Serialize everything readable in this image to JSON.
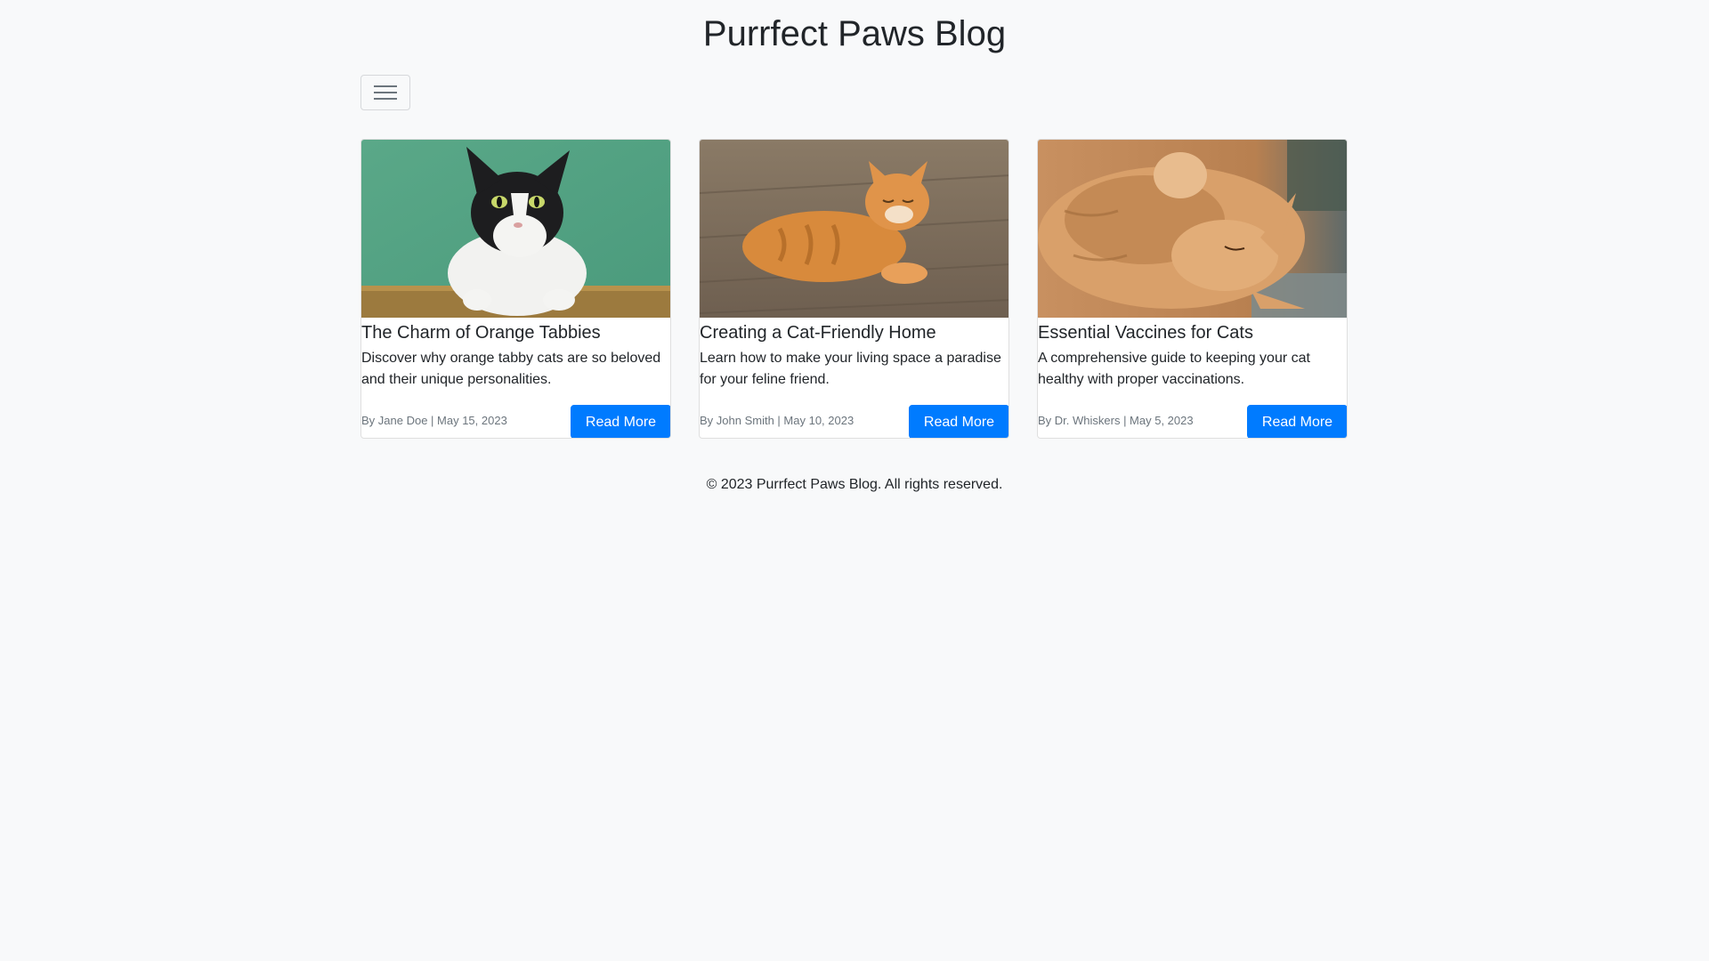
{
  "header": {
    "title": "Purrfect Paws Blog",
    "menu_icon": "hamburger-menu-icon"
  },
  "posts": [
    {
      "image": "black-white-cat-photo",
      "title": "The Charm of Orange Tabbies",
      "excerpt": "Discover why orange tabby cats are so beloved and their unique personalities.",
      "meta": "By Jane Doe | May 15, 2023",
      "button_label": "Read More"
    },
    {
      "image": "orange-tabby-lying-photo",
      "title": "Creating a Cat-Friendly Home",
      "excerpt": "Learn how to make your living space a paradise for your feline friend.",
      "meta": "By John Smith | May 10, 2023",
      "button_label": "Read More"
    },
    {
      "image": "fluffy-orange-cat-photo",
      "title": "Essential Vaccines for Cats",
      "excerpt": "A comprehensive guide to keeping your cat healthy with proper vaccinations.",
      "meta": "By Dr. Whiskers | May 5, 2023",
      "button_label": "Read More"
    }
  ],
  "footer": {
    "text": "© 2023 Purrfect Paws Blog. All rights reserved."
  },
  "colors": {
    "background": "#f8f9fa",
    "primary_button": "#007bff",
    "muted_text": "#6c757d"
  }
}
